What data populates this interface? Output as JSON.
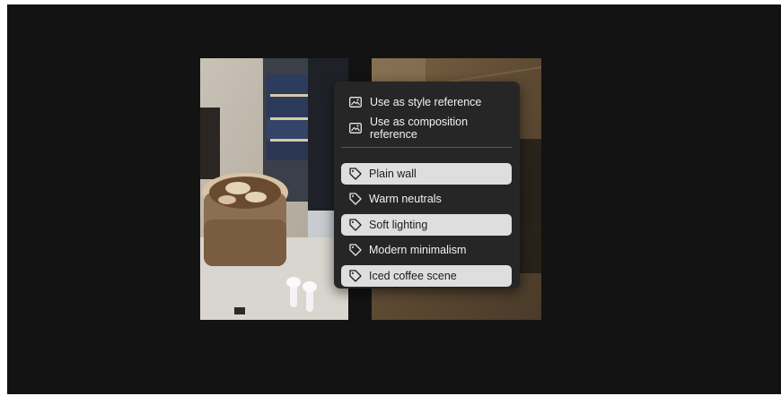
{
  "context_menu": {
    "reference_items": [
      {
        "label": "Use as style reference",
        "icon": "image-icon"
      },
      {
        "label": "Use as composition reference",
        "icon": "image-icon"
      }
    ],
    "tags": [
      {
        "label": "Plain wall",
        "icon": "tag-icon",
        "selected": true
      },
      {
        "label": "Warm neutrals",
        "icon": "tag-icon",
        "selected": false
      },
      {
        "label": "Soft lighting",
        "icon": "tag-icon",
        "selected": true
      },
      {
        "label": "Modern minimalism",
        "icon": "tag-icon",
        "selected": false
      },
      {
        "label": "Iced coffee scene",
        "icon": "tag-icon",
        "selected": true
      }
    ]
  },
  "colors": {
    "background": "#131313",
    "menu": "#262626",
    "selected_tag": "#dedede"
  }
}
